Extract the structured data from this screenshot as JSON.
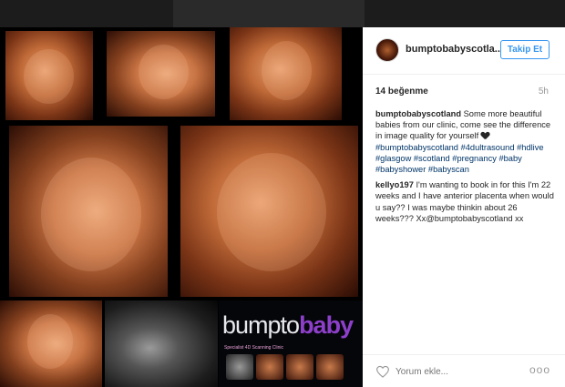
{
  "post": {
    "username": "bumptobabyscotla...",
    "follow_label": "Takip Et",
    "likes": "14 beğenme",
    "time": "5h",
    "comment_placeholder": "Yorum ekle...",
    "more_label": "ooo"
  },
  "caption": {
    "author": "bumptobabyscotland",
    "text": "Some more beautiful babies from our clinic, come see the difference in image quality for yourself",
    "tags": [
      "#bumptobabyscotland",
      "#4dultrasound",
      "#hdlive",
      "#glasgow",
      "#scotland",
      "#pregnancy",
      "#baby",
      "#babyshower",
      "#babyscan"
    ]
  },
  "reply": {
    "author": "kellyo197",
    "text": "I'm wanting to book in for this I'm 22 weeks and I have anterior placenta when would u say?? I was maybe thinkin about 26 weeks???",
    "mention": "Xx@bumptobabyscotland xx"
  },
  "logo": {
    "part1": "bumpto",
    "part2": "baby",
    "subtitle": "Specialist 4D Scanning Clinic"
  },
  "colors": {
    "accent": "#3897f0",
    "hashtag": "#003569",
    "logo_purple": "#8d3fc9"
  }
}
